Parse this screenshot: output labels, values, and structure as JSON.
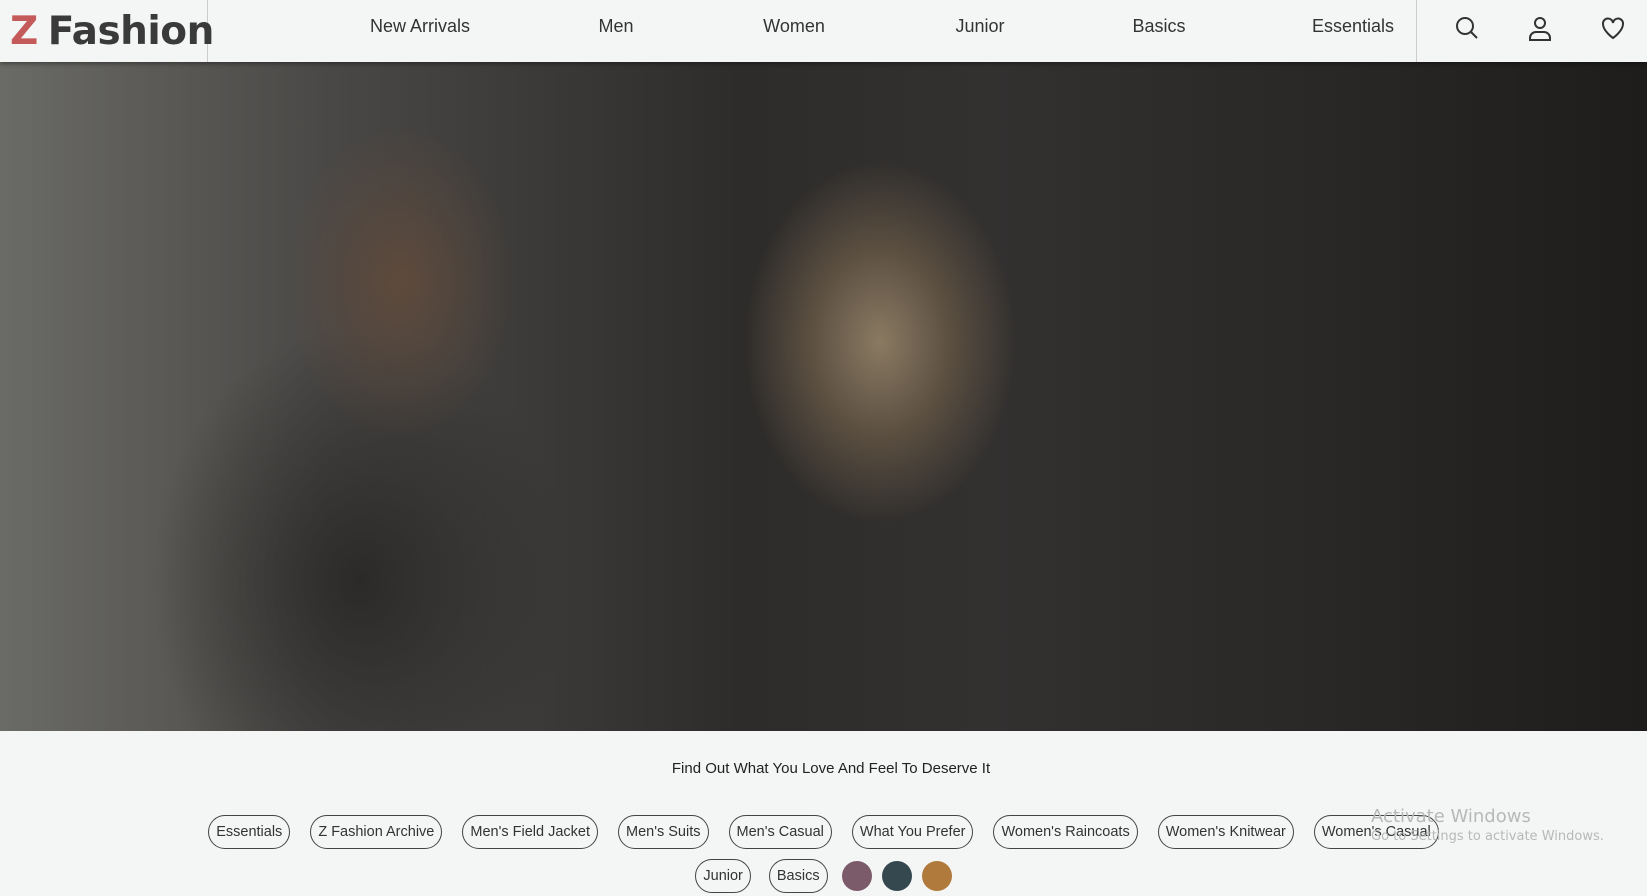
{
  "brand": {
    "prefix": "Z",
    "name": "Fashion"
  },
  "nav": [
    "New Arrivals",
    "Men",
    "Women",
    "Junior",
    "Basics",
    "Essentials"
  ],
  "icons": [
    "search-icon",
    "user-icon",
    "heart-icon"
  ],
  "tagline": "Find Out What You Love And Feel To Deserve It",
  "tags_row1": [
    "Essentials",
    "Z Fashion Archive",
    "Men's Field Jacket",
    "Men's Suits",
    "Men's Casual",
    "What You Prefer",
    "Women's Raincoats",
    "Women's Knitwear",
    "Women's Casual"
  ],
  "tags_row2": [
    "Junior",
    "Basics"
  ],
  "swatches": [
    "#7b5b69",
    "#35474f",
    "#b07a3c"
  ],
  "watermark": {
    "title": "Activate Windows",
    "subtitle": "Go to Settings to activate Windows."
  }
}
